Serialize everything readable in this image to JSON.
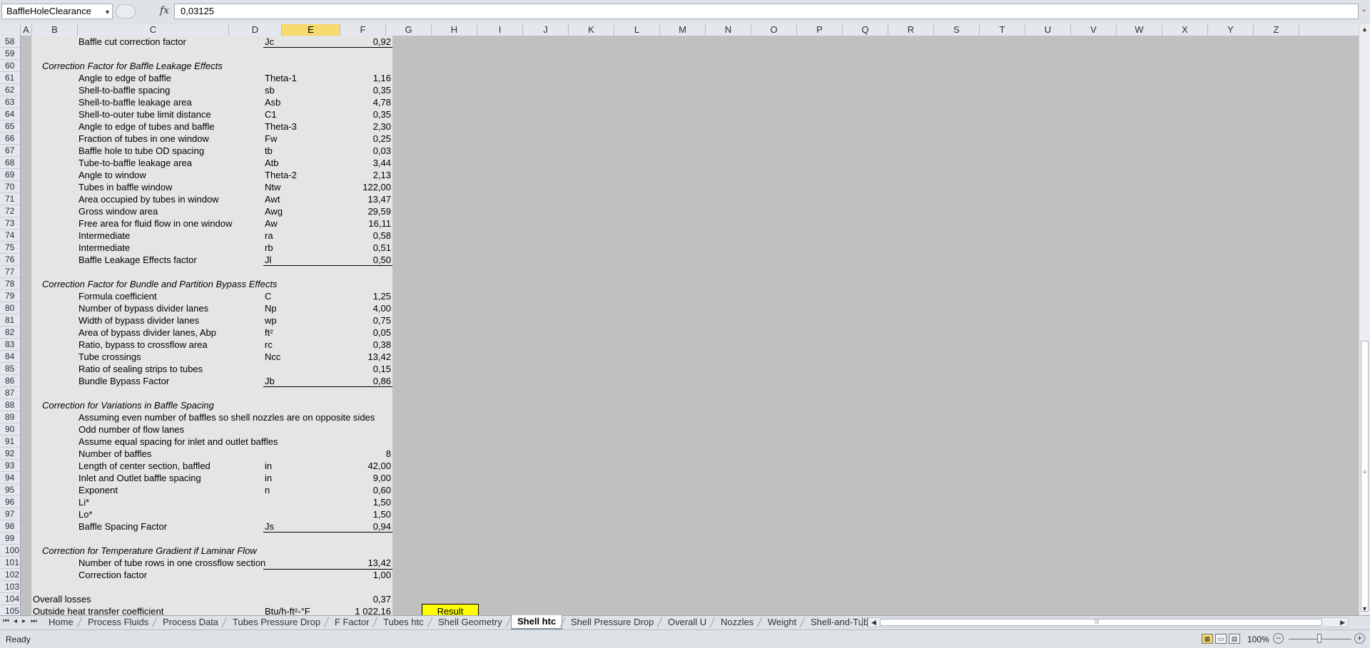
{
  "formula_bar": {
    "name_box": "BaffleHoleClearance",
    "fx_icon": "fx",
    "formula": "0,03125"
  },
  "columns": [
    "A",
    "B",
    "C",
    "D",
    "E",
    "F",
    "G",
    "H",
    "I",
    "J",
    "K",
    "L",
    "M",
    "N",
    "O",
    "P",
    "Q",
    "R",
    "S",
    "T",
    "U",
    "V",
    "W",
    "X",
    "Y",
    "Z"
  ],
  "selected_column": "E",
  "rows": [
    {
      "n": "58",
      "label": "Baffle cut correction factor",
      "sym": "Jc",
      "val": "0,92",
      "under": true
    },
    {
      "n": "59"
    },
    {
      "n": "60",
      "sec": "Correction Factor for Baffle Leakage Effects"
    },
    {
      "n": "61",
      "label": "Angle to edge of baffle",
      "sym": "Theta-1",
      "val": "1,16"
    },
    {
      "n": "62",
      "label": "Shell-to-baffle spacing",
      "sym": "sb",
      "val": "0,35"
    },
    {
      "n": "63",
      "label": "Shell-to-baffle leakage area",
      "sym": "Asb",
      "val": "4,78"
    },
    {
      "n": "64",
      "label": "Shell-to-outer tube limit distance",
      "sym": "C1",
      "val": "0,35"
    },
    {
      "n": "65",
      "label": "Angle to edge of tubes and baffle",
      "sym": "Theta-3",
      "val": "2,30"
    },
    {
      "n": "66",
      "label": "Fraction of tubes in one window",
      "sym": "Fw",
      "val": "0,25"
    },
    {
      "n": "67",
      "label": "Baffle hole to tube OD spacing",
      "sym": "tb",
      "val": "0,03"
    },
    {
      "n": "68",
      "label": "Tube-to-baffle leakage area",
      "sym": "Atb",
      "val": "3,44"
    },
    {
      "n": "69",
      "label": "Angle to window",
      "sym": "Theta-2",
      "val": "2,13"
    },
    {
      "n": "70",
      "label": "Tubes in baffle window",
      "sym": "Ntw",
      "val": "122,00"
    },
    {
      "n": "71",
      "label": "Area occupied by tubes in window",
      "sym": "Awt",
      "val": "13,47"
    },
    {
      "n": "72",
      "label": "Gross window area",
      "sym": "Awg",
      "val": "29,59"
    },
    {
      "n": "73",
      "label": "Free area for fluid flow in one window",
      "sym": "Aw",
      "val": "16,11"
    },
    {
      "n": "74",
      "label": "Intermediate",
      "sym": "ra",
      "val": "0,58"
    },
    {
      "n": "75",
      "label": "Intermediate",
      "sym": "rb",
      "val": "0,51"
    },
    {
      "n": "76",
      "label": "Baffle Leakage Effects factor",
      "sym": "Jl",
      "val": "0,50",
      "under": true
    },
    {
      "n": "77"
    },
    {
      "n": "78",
      "sec": "Correction Factor for Bundle and Partition Bypass Effects"
    },
    {
      "n": "79",
      "label": "Formula coefficient",
      "sym": "C",
      "val": "1,25"
    },
    {
      "n": "80",
      "label": "Number of bypass divider lanes",
      "sym": "Np",
      "val": "4,00"
    },
    {
      "n": "81",
      "label": "Width of bypass divider lanes",
      "sym": "wp",
      "val": "0,75"
    },
    {
      "n": "82",
      "label": "Area of bypass divider lanes, Abp",
      "sym": "ft²",
      "val": "0,05"
    },
    {
      "n": "83",
      "label": "Ratio, bypass to crossflow area",
      "sym": "rc",
      "val": "0,38"
    },
    {
      "n": "84",
      "label": "Tube crossings",
      "sym": "Ncc",
      "val": "13,42"
    },
    {
      "n": "85",
      "label": "Ratio of sealing strips to tubes",
      "val": "0,15"
    },
    {
      "n": "86",
      "label": "Bundle Bypass Factor",
      "sym": "Jb",
      "val": "0,86",
      "under": true
    },
    {
      "n": "87"
    },
    {
      "n": "88",
      "sec": "Correction for Variations in Baffle Spacing"
    },
    {
      "n": "89",
      "label": "Assuming even number of baffles so shell nozzles are on opposite sides"
    },
    {
      "n": "90",
      "label": "Odd number of flow lanes"
    },
    {
      "n": "91",
      "label": "Assume equal spacing for inlet and outlet baffles"
    },
    {
      "n": "92",
      "label": "Number of baffles",
      "val": "8"
    },
    {
      "n": "93",
      "label": "Length of center section, baffled",
      "sym": "in",
      "val": "42,00"
    },
    {
      "n": "94",
      "label": "Inlet and Outlet baffle spacing",
      "sym": "in",
      "val": "9,00"
    },
    {
      "n": "95",
      "label": "Exponent",
      "sym": "n",
      "val": "0,60"
    },
    {
      "n": "96",
      "label": "Li*",
      "val": "1,50"
    },
    {
      "n": "97",
      "label": "Lo*",
      "val": "1,50"
    },
    {
      "n": "98",
      "label": "Baffle Spacing Factor",
      "sym": "Js",
      "val": "0,94",
      "under": true
    },
    {
      "n": "99"
    },
    {
      "n": "100",
      "sec": "Correction for Temperature Gradient if Laminar Flow"
    },
    {
      "n": "101",
      "label": "Number of tube rows in one crossflow section",
      "val": "13,42"
    },
    {
      "n": "102",
      "label": "Correction factor",
      "val": "1,00",
      "over": true
    },
    {
      "n": "103"
    },
    {
      "n": "104",
      "root": "Overall losses",
      "val": "0,37"
    },
    {
      "n": "105",
      "root": "Outside heat transfer coefficient",
      "sym": "Btu/h-ft²-°F",
      "val": "1 022,16"
    },
    {
      "n": "106"
    }
  ],
  "result_label": "Result",
  "tabs": [
    "Home",
    "Process Fluids",
    "Process Data",
    "Tubes Pressure Drop",
    "F Factor",
    "Tubes htc",
    "Shell Geometry",
    "Shell htc",
    "Shell Pressure Drop",
    "Overall U",
    "Nozzles",
    "Weight",
    "Shell-and-Tube"
  ],
  "active_tab": "Shell htc",
  "status": {
    "text": "Ready",
    "zoom": "100%",
    "zoom_out": "−",
    "zoom_in": "+"
  }
}
